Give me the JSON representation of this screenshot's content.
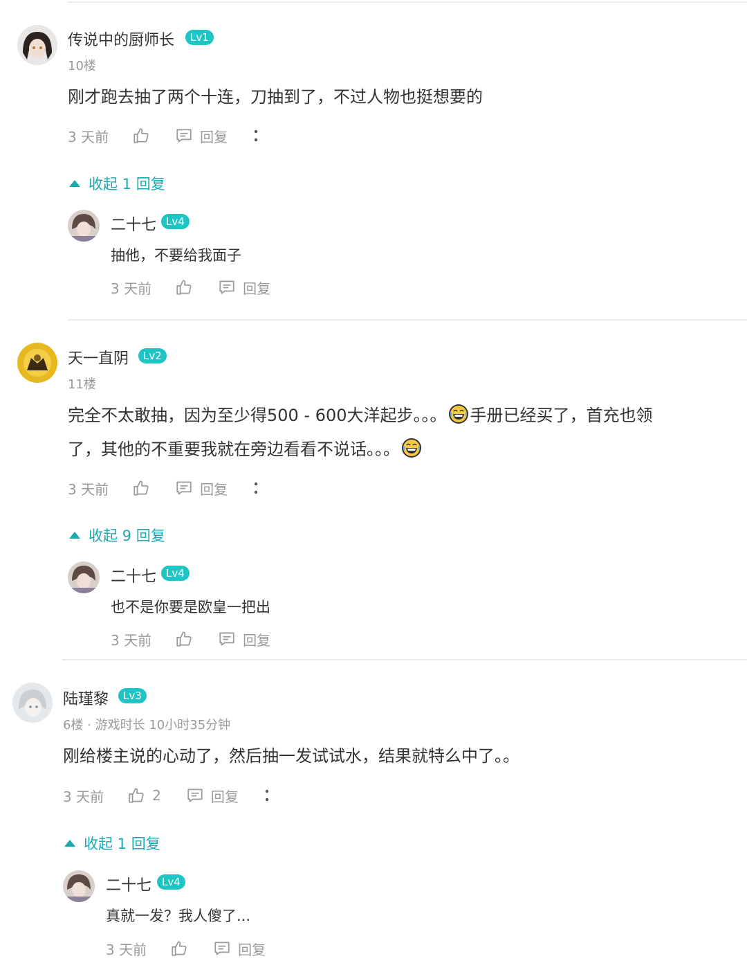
{
  "comments": [
    {
      "user": "传说中的厨师长",
      "level": "Lv1",
      "floor": "10楼",
      "text": "刚才跑去抽了两个十连，刀抽到了，不过人物也挺想要的",
      "time": "3 天前",
      "reply_label": "回复",
      "collapse_label": "收起 1 回复",
      "reply": {
        "user": "二十七",
        "level": "Lv4",
        "text": "抽他，不要给我面子",
        "time": "3 天前",
        "reply_label": "回复"
      }
    },
    {
      "user": "天一直阴",
      "level": "Lv2",
      "floor": "11楼",
      "text_line1a": "完全不太敢抽，因为至少得500 - 600大洋起步。。。",
      "text_line1b": "手册已经买了，首充也领",
      "text_line2": "了，其他的不重要我就在旁边看看不说话。。。",
      "time": "3 天前",
      "reply_label": "回复",
      "collapse_label": "收起 9 回复",
      "reply": {
        "user": "二十七",
        "level": "Lv4",
        "text": "也不是你要是欧皇一把出",
        "time": "3 天前",
        "reply_label": "回复"
      }
    },
    {
      "user": "陆瑾黎",
      "level": "Lv3",
      "floor": "6楼 · 游戏时长 10小时35分钟",
      "text": "刚给楼主说的心动了，然后抽一发试试水，结果就特么中了。。",
      "time": "3 天前",
      "likes": "2",
      "reply_label": "回复",
      "collapse_label": "收起 1 回复",
      "reply": {
        "user": "二十七",
        "level": "Lv4",
        "text": "真就一发？我人傻了...",
        "time": "3 天前",
        "reply_label": "回复"
      }
    }
  ],
  "colors": {
    "accent": "#1aa9b3",
    "level_badge": "#1fc5c5",
    "meta_gray": "#9a9a9a"
  },
  "icons": [
    "thumbs-up-icon",
    "reply-bubble-icon",
    "more-vertical-icon",
    "collapse-triangle-icon",
    "laughing-emoji-icon"
  ]
}
